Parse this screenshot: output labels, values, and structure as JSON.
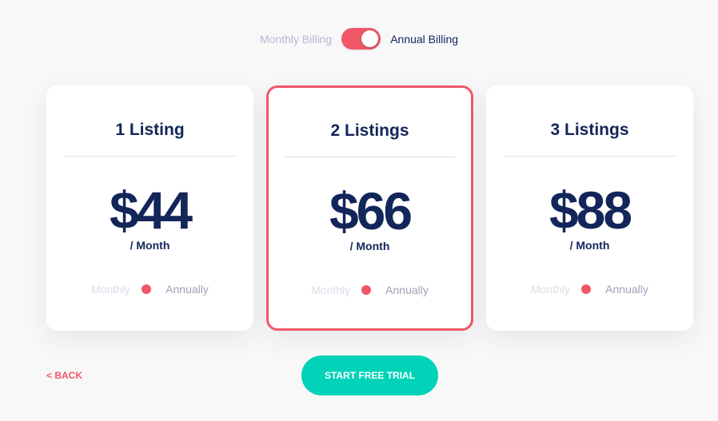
{
  "billing": {
    "monthly_label": "Monthly Billing",
    "annual_label": "Annual Billing",
    "annual_selected": true
  },
  "plans": [
    {
      "title": "1 Listing",
      "price": "$44",
      "period": "/ Month",
      "toggle_monthly": "Monthly",
      "toggle_annual": "Annually",
      "selected": false
    },
    {
      "title": "2 Listings",
      "price": "$66",
      "period": "/ Month",
      "toggle_monthly": "Monthly",
      "toggle_annual": "Annually",
      "selected": true
    },
    {
      "title": "3 Listings",
      "price": "$88",
      "period": "/ Month",
      "toggle_monthly": "Monthly",
      "toggle_annual": "Annually",
      "selected": false
    }
  ],
  "actions": {
    "back_label": "< BACK",
    "cta_label": "START FREE TRIAL"
  },
  "colors": {
    "accent": "#f25767",
    "cta": "#00d3b8",
    "text_primary": "#13265a"
  }
}
